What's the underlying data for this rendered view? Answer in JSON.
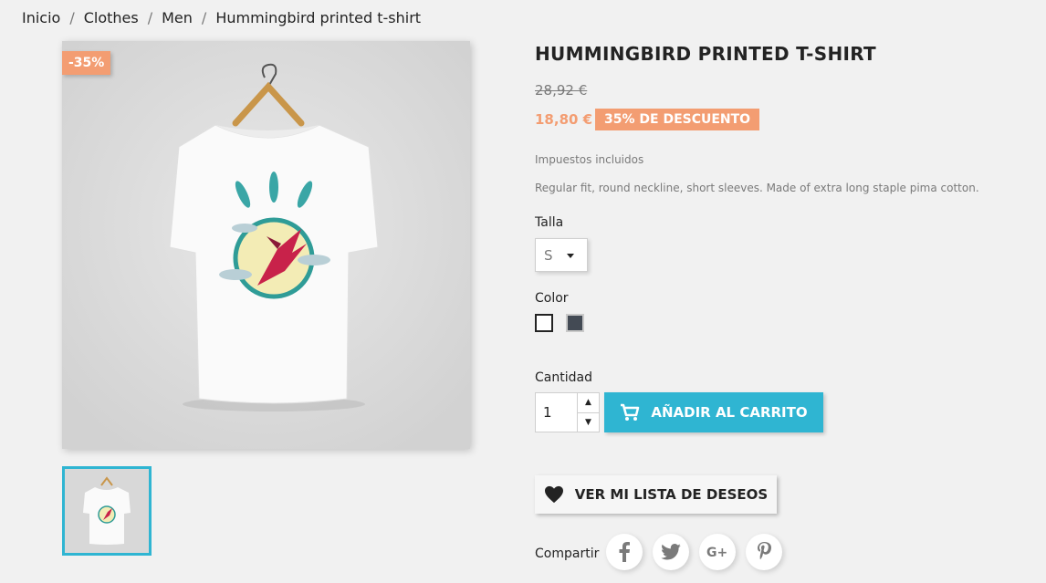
{
  "breadcrumb": [
    "Inicio",
    "Clothes",
    "Men",
    "Hummingbird printed t-shirt"
  ],
  "product": {
    "discount_flag": "-35%",
    "title": "HUMMINGBIRD PRINTED T-SHIRT",
    "regular_price": "28,92 €",
    "current_price": "18,80 €",
    "discount_badge": "35% DE DESCUENTO",
    "tax_label": "Impuestos incluidos",
    "description": "Regular fit, round neckline, short sleeves. Made of extra long staple pima cotton."
  },
  "variants": {
    "size_label": "Talla",
    "size_value": "S",
    "color_label": "Color",
    "colors": [
      "#ffffff",
      "#434a54"
    ]
  },
  "purchase": {
    "quantity_label": "Cantidad",
    "quantity_value": "1",
    "add_to_cart": "AÑADIR AL CARRITO",
    "wishlist": "VER MI LISTA DE DESEOS"
  },
  "share": {
    "label": "Compartir",
    "networks": [
      "facebook-icon",
      "twitter-icon",
      "google-plus-icon",
      "pinterest-icon"
    ]
  },
  "colors": {
    "accent": "#2fb5d2",
    "discount": "#f39d72",
    "background": "#f1f1f1"
  }
}
